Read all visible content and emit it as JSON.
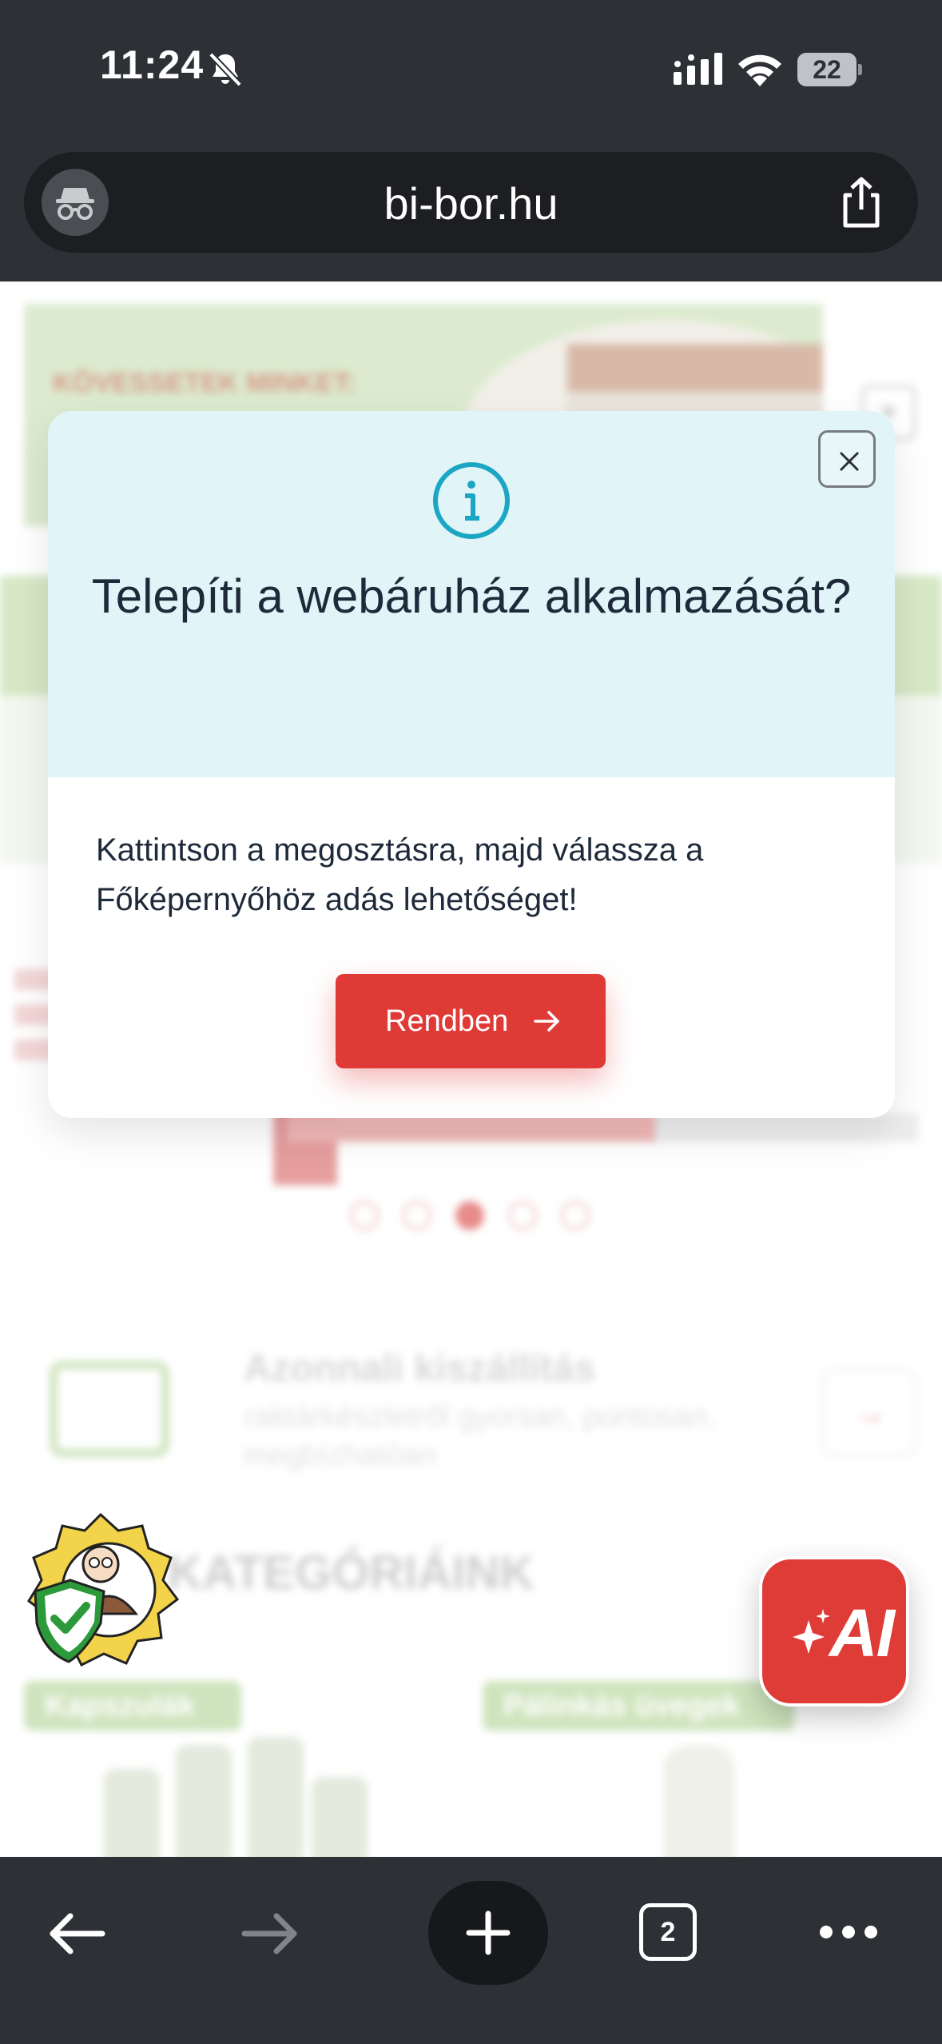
{
  "status_bar": {
    "time": "11:24",
    "battery_level": "22",
    "silent_mode": true,
    "wifi": true
  },
  "browser": {
    "url": "bi-bor.hu",
    "open_tabs": "2",
    "icons": [
      "incognito-icon",
      "share-icon",
      "back-arrow-icon",
      "forward-arrow-icon",
      "plus-icon",
      "tabs-icon",
      "more-icon"
    ]
  },
  "background_page": {
    "banner_text": "KÖVESSETEK MINKET:",
    "feature_title": "Azonnali kiszállítás",
    "feature_subtitle": "raktárkészletről gyorsan, pontosan, megbízhatóan",
    "categories_title": "KATEGÓRIÁINK",
    "category_1": "Kapszulák",
    "category_2": "Pálinkás üvegek",
    "carousel_active_index": 2,
    "carousel_count": 5
  },
  "modal": {
    "title": "Telepíti a webáruház alkalmazását?",
    "body": "Kattintson a megosztásra, majd válassza a Főképernyőhöz adás lehetőséget!",
    "ok_label": "Rendben",
    "accent_color": "#e03a37",
    "header_color": "#e1f4f8"
  },
  "ai_button": {
    "label": "AI"
  }
}
